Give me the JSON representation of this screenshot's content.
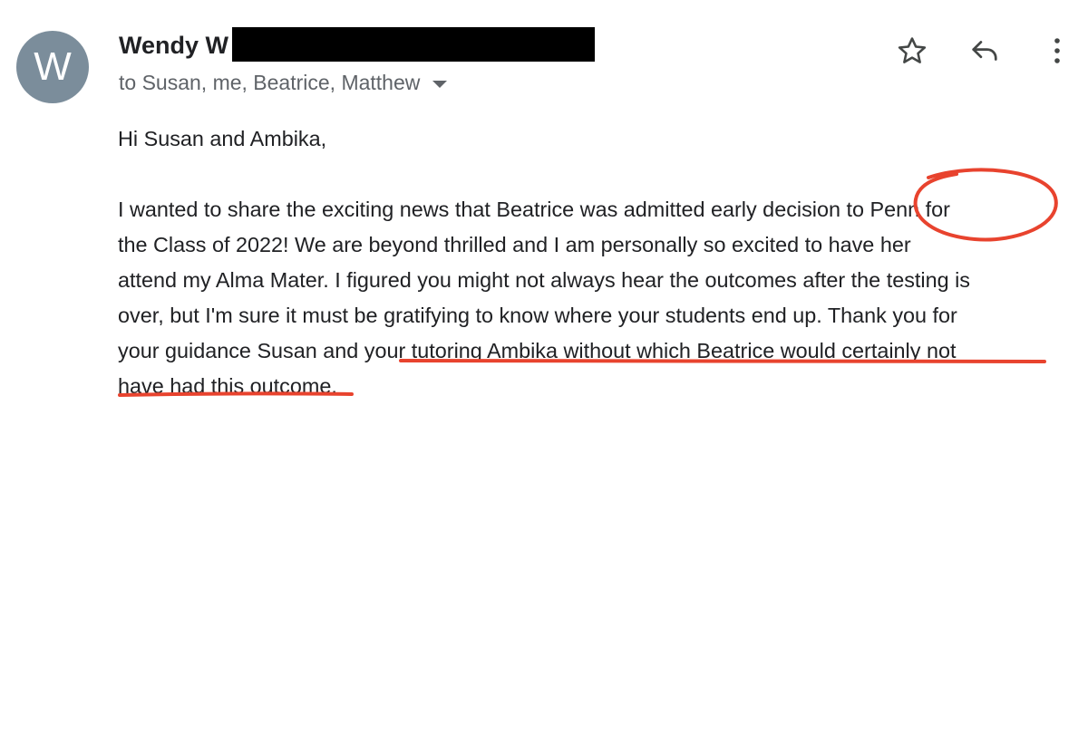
{
  "header": {
    "avatar_letter": "W",
    "sender_name": "Wendy W",
    "recipients": "to Susan, me, Beatrice, Matthew"
  },
  "actions": {
    "star_icon": "star-outline",
    "reply_icon": "reply-arrow",
    "more_icon": "vertical-dots"
  },
  "message": {
    "greeting": "Hi Susan and Ambika,",
    "lines": [
      "I wanted to share the exciting news that Beatrice was admitted early decision to Penn for",
      "the Class of 2022!  We are beyond thrilled and I am personally so excited to have her",
      "attend my Alma Mater.  I figured you might not always hear the outcomes after the testing is",
      "over, but I'm sure it must be gratifying to know where your students end up.  Thank you for",
      "your guidance Susan and your tutoring Ambika without which Beatrice would certainly not",
      "have had this outcome."
    ]
  },
  "colors": {
    "avatar_bg": "#7b8d9b",
    "annotation_red": "#e8432e"
  }
}
